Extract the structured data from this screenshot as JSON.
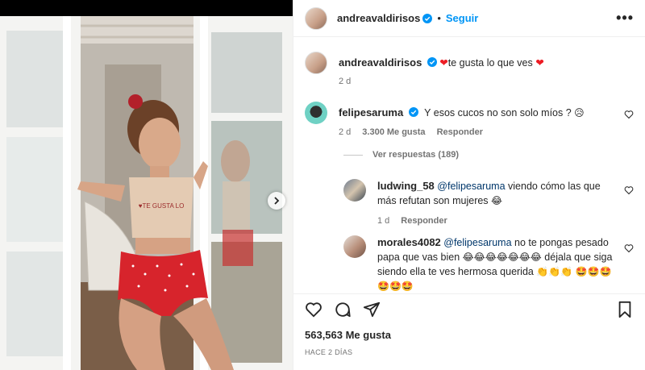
{
  "post": {
    "author": "andreavaldirisos",
    "follow_label": "Seguir",
    "separator": "•",
    "more_label": "•••",
    "caption": {
      "author": "andreavaldirisos",
      "heart_before": "❤",
      "text": "te gusta lo que ves",
      "heart_after": "❤",
      "time": "2 d"
    },
    "shirt_text": "♥TE GUSTA LO"
  },
  "comments": [
    {
      "username": "felipesaruma",
      "verified": true,
      "text": "Y esos cucos no son solo míos ?",
      "emoji": "😥",
      "time": "2 d",
      "likes": "3.300 Me gusta",
      "reply_label": "Responder",
      "view_replies": "Ver respuestas (189)"
    },
    {
      "username": "ludwing_58",
      "mention": "@felipesaruma",
      "text": "viendo cómo las que más refutan son mujeres",
      "emoji": "😂",
      "time": "1 d",
      "reply_label": "Responder"
    },
    {
      "username": "morales4082",
      "mention": "@felipesaruma",
      "text_a": "no te pongas pesado papa que vas bien",
      "emoji_a": "😂😂😂😂😂😂😂",
      "text_b": "déjala que siga siendo ella te ves hermosa querida",
      "emoji_b": "👏👏👏",
      "emoji_c": "🤩🤩🤩🤩🤩🤩"
    }
  ],
  "actions": {
    "like_icon": "heart-icon",
    "comment_icon": "comment-icon",
    "share_icon": "share-icon",
    "save_icon": "bookmark-icon"
  },
  "likes_label": "563,563 Me gusta",
  "time_ago": "HACE 2 DÍAS",
  "colors": {
    "accent": "#0095f6",
    "verified": "#0095f6",
    "heart_red": "#ed1c24",
    "muted": "#737373"
  }
}
